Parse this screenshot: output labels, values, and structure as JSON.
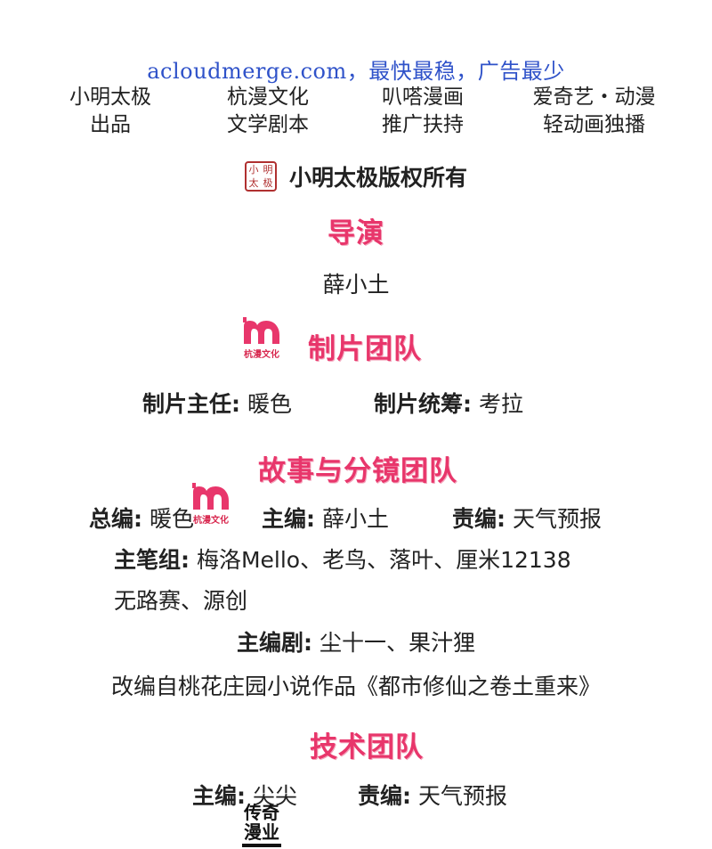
{
  "watermark": "acloudmerge.com，最快最稳，广告最少",
  "partners": [
    {
      "line1": "小明太极",
      "line2": "出品"
    },
    {
      "line1": "杭漫文化",
      "line2": "文学剧本"
    },
    {
      "line1": "叭嗒漫画",
      "line2": "推广扶持"
    },
    {
      "line1": "爱奇艺・动漫",
      "line2": "轻动画独播"
    }
  ],
  "copyright": {
    "seal_chars": [
      "小",
      "明",
      "太",
      "极"
    ],
    "text": "小明太极版权所有"
  },
  "director": {
    "title": "导演",
    "name": "薛小土"
  },
  "production": {
    "title": "制片团队",
    "logo_caption": "杭漫文化",
    "manager_label": "制片主任:",
    "manager": "暖色",
    "coordinator_label": "制片统筹:",
    "coordinator": "考拉"
  },
  "story": {
    "title": "故事与分镜团队",
    "logo_caption": "杭漫文化",
    "chief_label": "总编:",
    "chief": "暖色",
    "editor_label": "主编:",
    "editor": "薛小土",
    "resp_label": "责编:",
    "resp": "天气预报",
    "pen_label": "主笔组:",
    "pen_line1": "梅洛Mello、老鸟、落叶、厘米12138",
    "pen_line2": "无路赛、源创",
    "writer_label": "主编剧:",
    "writers": "尘十一、果汁狸",
    "adapted": "改编自桃花庄园小说作品《都市修仙之卷土重来》"
  },
  "tech": {
    "title": "技术团队",
    "logo_line1": "传奇",
    "logo_line2": "漫业",
    "editor_label": "主编:",
    "editor": "尖尖",
    "resp_label": "责编:",
    "resp": "天气预报"
  },
  "colors": {
    "accent_pink": "#e8366b",
    "watermark_blue": "#2f52c9",
    "seal_red": "#b03030"
  }
}
